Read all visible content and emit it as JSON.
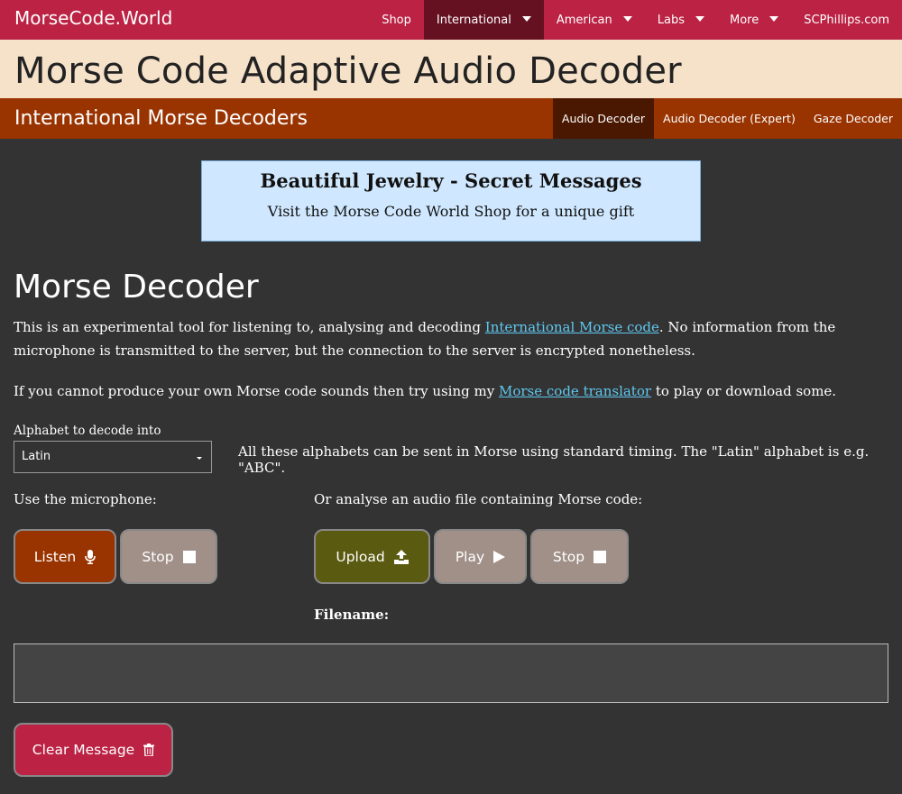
{
  "nav": {
    "brand": "MorseCode.World",
    "links": [
      {
        "label": "Shop",
        "dropdown": false,
        "active": false
      },
      {
        "label": "International",
        "dropdown": true,
        "active": true
      },
      {
        "label": "American",
        "dropdown": true,
        "active": false
      },
      {
        "label": "Labs",
        "dropdown": true,
        "active": false
      },
      {
        "label": "More",
        "dropdown": true,
        "active": false
      },
      {
        "label": "SCPhillips.com",
        "dropdown": false,
        "active": false
      }
    ]
  },
  "page_title": "Morse Code Adaptive Audio Decoder",
  "section_bar": {
    "title": "International Morse Decoders",
    "tabs": [
      {
        "label": "Audio Decoder",
        "active": true
      },
      {
        "label": "Audio Decoder (Expert)",
        "active": false
      },
      {
        "label": "Gaze Decoder",
        "active": false
      }
    ]
  },
  "ad": {
    "title": "Beautiful Jewelry - Secret Messages",
    "text": "Visit the Morse Code World Shop for a unique gift"
  },
  "main": {
    "heading": "Morse Decoder",
    "intro_before_link": "This is an experimental tool for listening to, analysing and decoding ",
    "intro_link": "International Morse code",
    "intro_after_link": ". No information from the microphone is transmitted to the server, but the connection to the server is encrypted nonetheless.",
    "translator_before_link": "If you cannot produce your own Morse code sounds then try using my ",
    "translator_link": "Morse code translator",
    "translator_after_link": " to play or download some.",
    "alphabet_label": "Alphabet to decode into",
    "alphabet_value": "Latin",
    "alphabet_note": "All these alphabets can be sent in Morse using standard timing. The \"Latin\" alphabet is e.g. \"ABC\".",
    "mic_label": "Use the microphone:",
    "file_label": "Or analyse an audio file containing Morse code:",
    "listen_button": "Listen",
    "stop_button": "Stop",
    "upload_button": "Upload",
    "play_button": "Play",
    "stop_button_2": "Stop",
    "filename_label": "Filename:",
    "filename_value": "",
    "message_text": "",
    "clear_button": "Clear Message"
  },
  "colors": {
    "nav_bg": "#bb2244",
    "nav_active": "#661122",
    "title_band": "#f6e1c9",
    "section_bar": "#993300",
    "section_active": "#4a1800",
    "page_bg": "#333333",
    "link": "#5fc8f0",
    "listen_btn": "#993300",
    "upload_btn": "#5a5a10",
    "grey_btn": "#a09088",
    "clear_btn": "#bb2244"
  },
  "icons": {
    "listen": "microphone-icon",
    "stop": "stop-square-icon",
    "upload": "upload-icon",
    "play": "play-triangle-icon",
    "clear": "trash-icon"
  }
}
